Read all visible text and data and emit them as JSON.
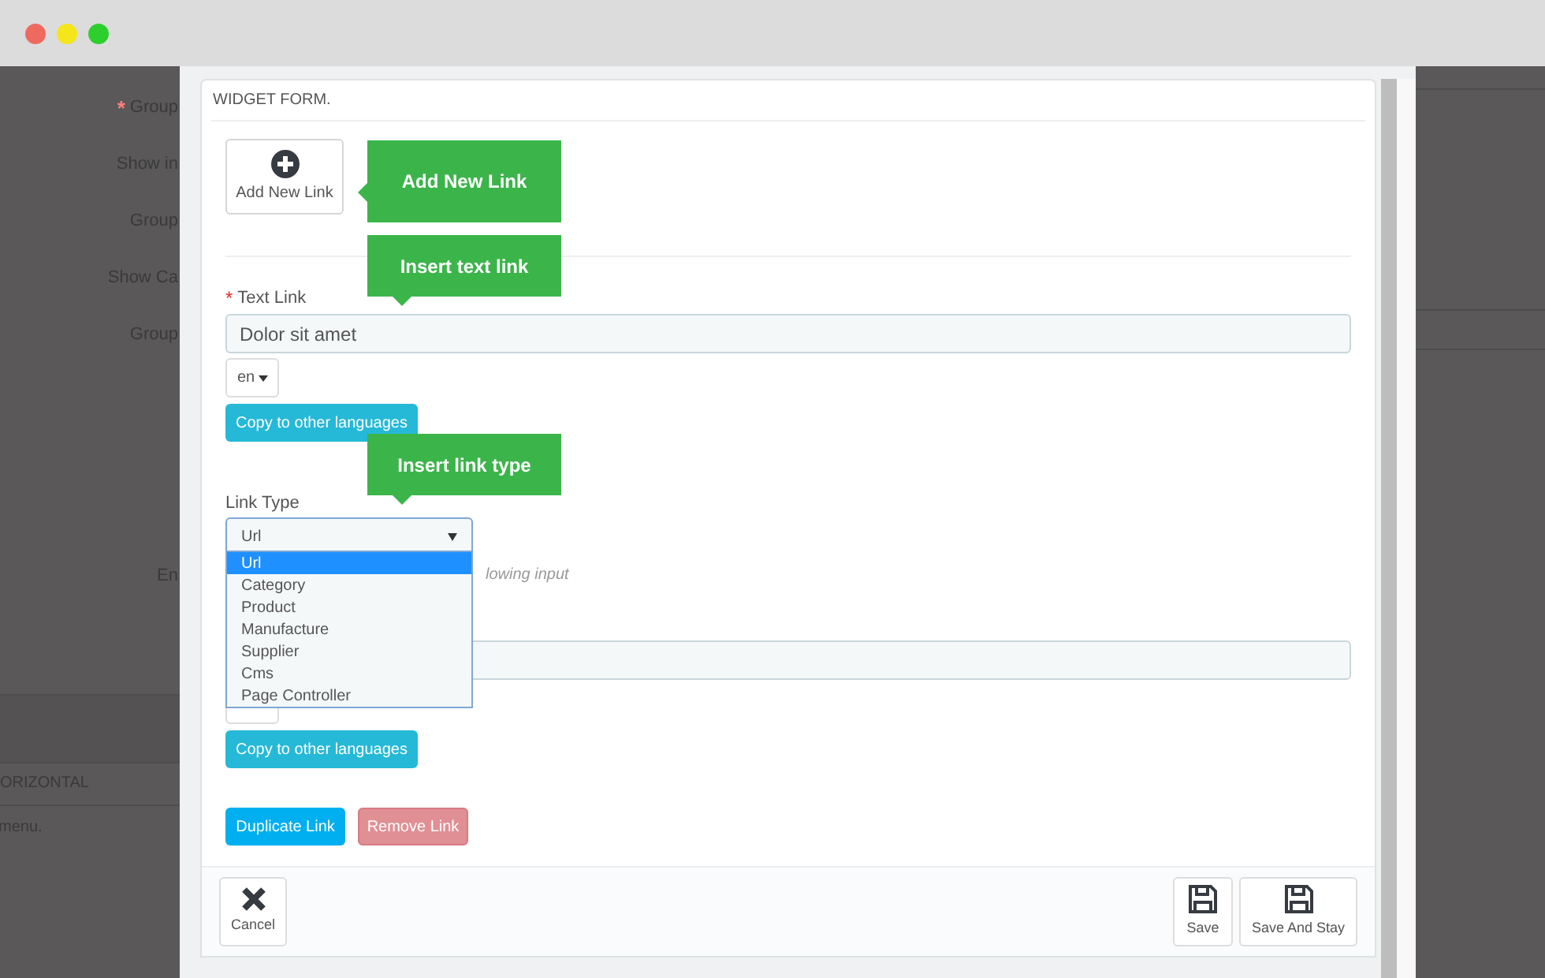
{
  "background_labels": [
    {
      "mark": "*",
      "text": "Group"
    },
    {
      "text": "Show in"
    },
    {
      "text": "Group"
    },
    {
      "text": "Show Ca"
    },
    {
      "text": "Group"
    }
  ],
  "background_extra": {
    "label": "En",
    "section": "ORIZONTAL",
    "note": "menu."
  },
  "panel": {
    "title": "WIDGET FORM.",
    "add_button": "Add New Link",
    "text_link": {
      "label": "Text Link",
      "mark": "*",
      "value": "Dolor sit amet",
      "lang": "en",
      "copy_button": "Copy to other languages"
    },
    "link_type": {
      "label": "Link Type",
      "value": "Url",
      "hint": "lowing input",
      "options": [
        {
          "label": "Url",
          "selected": true
        },
        {
          "label": "Category",
          "selected": false
        },
        {
          "label": "Product",
          "selected": false
        },
        {
          "label": "Manufacture",
          "selected": false
        },
        {
          "label": "Supplier",
          "selected": false
        },
        {
          "label": "Cms",
          "selected": false
        },
        {
          "label": "Page Controller",
          "selected": false
        }
      ]
    },
    "second_copy_button": "Copy to other languages",
    "duplicate_button": "Duplicate Link",
    "remove_button": "Remove Link"
  },
  "callouts": [
    {
      "text": "Add New Link",
      "kind": "left"
    },
    {
      "text": "Insert text link",
      "kind": "bottom"
    },
    {
      "text": "Insert link type",
      "kind": "bottom"
    }
  ],
  "footer": {
    "cancel": "Cancel",
    "save": "Save",
    "save_stay": "Save And Stay"
  }
}
